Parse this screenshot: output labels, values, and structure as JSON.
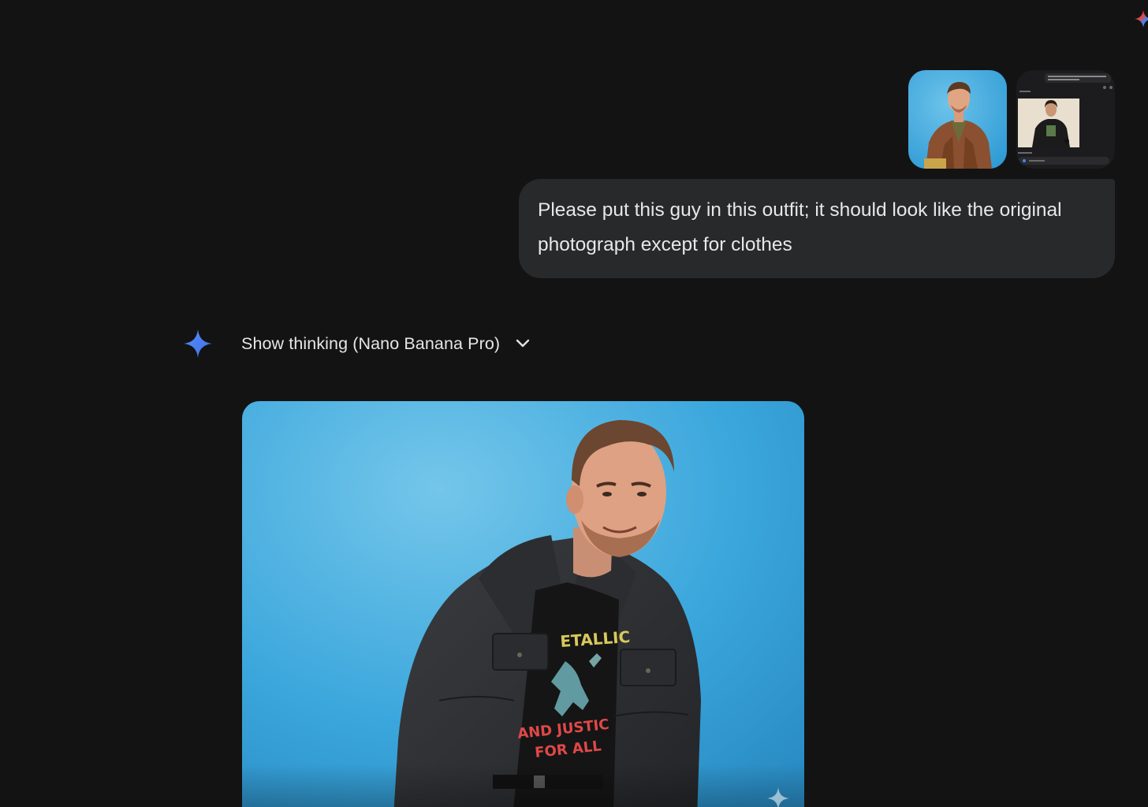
{
  "chat": {
    "user_message": {
      "text": "Please put this guy in this outfit; it should look like the original photograph except for clothes",
      "attachments": [
        {
          "kind": "photo",
          "subject": "man in brown corduroy jacket on blue background"
        },
        {
          "kind": "screenshot",
          "subject": "man in black Metallica t-shirt and dark jacket"
        }
      ]
    },
    "response": {
      "thinking_label": "Show thinking (Nano Banana Pro)",
      "image": {
        "subject": "man in dark denim jacket and Metallica ...And Justice For All t-shirt on blue background"
      }
    }
  },
  "shirt_print": {
    "band": "ETALLIC",
    "line1": "AND JUSTIC",
    "line2": "FOR ALL"
  },
  "icons": {
    "corner": "gemini-spark-icon",
    "response": "gemini-spark-icon",
    "toggle": "chevron-down-icon",
    "watermark": "sparkle-watermark-icon"
  },
  "colors": {
    "page_bg": "#131314",
    "bubble_bg": "#28292a",
    "spark_blue": "#4285f4",
    "photo_bg": "#3ba6dc"
  }
}
